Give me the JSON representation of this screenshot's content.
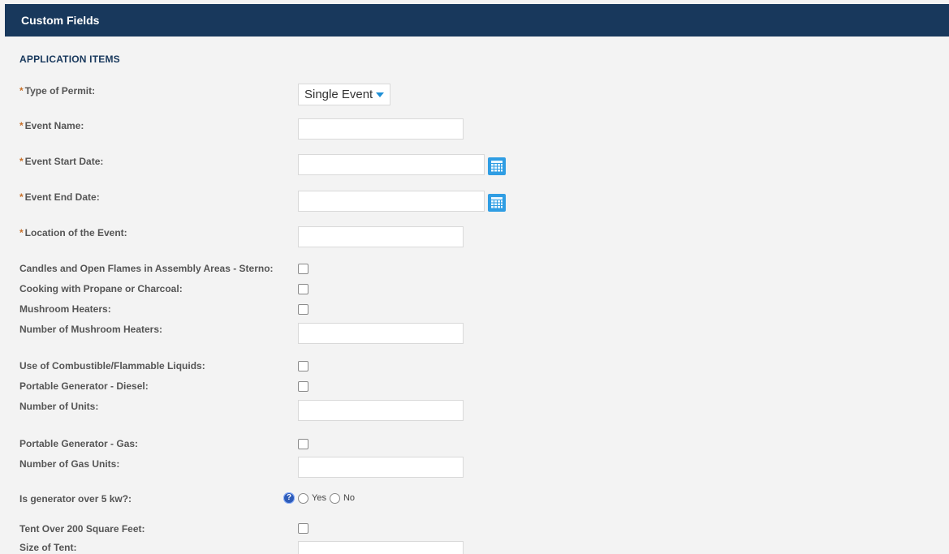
{
  "header": {
    "title": "Custom Fields"
  },
  "section": {
    "title": "APPLICATION ITEMS"
  },
  "fields": {
    "type_of_permit": {
      "label": "Type of Permit:",
      "value": "Single Event"
    },
    "event_name": {
      "label": "Event Name:"
    },
    "event_start_date": {
      "label": "Event Start Date:"
    },
    "event_end_date": {
      "label": "Event End Date:"
    },
    "location": {
      "label": "Location of the Event:"
    },
    "candles": {
      "label": "Candles and Open Flames in Assembly Areas - Sterno:"
    },
    "cooking": {
      "label": "Cooking with Propane or Charcoal:"
    },
    "mushroom_heaters": {
      "label": "Mushroom Heaters:"
    },
    "num_mushroom_heaters": {
      "label": "Number of Mushroom Heaters:"
    },
    "combustible": {
      "label": "Use of Combustible/Flammable Liquids:"
    },
    "gen_diesel": {
      "label": "Portable Generator - Diesel:"
    },
    "num_units": {
      "label": "Number of Units:"
    },
    "gen_gas": {
      "label": "Portable Generator - Gas:"
    },
    "num_gas_units": {
      "label": "Number of Gas Units:"
    },
    "gen_over_5kw": {
      "label": "Is generator over 5 kw?:",
      "yes": "Yes",
      "no": "No"
    },
    "tent": {
      "label": "Tent Over 200 Square Feet:"
    },
    "tent_size": {
      "label": "Size of Tent:"
    }
  },
  "required_marker": "*",
  "help_glyph": "?",
  "colors": {
    "header_bg": "#18385c",
    "required": "#c7702a",
    "calendar": "#2f9de3"
  }
}
